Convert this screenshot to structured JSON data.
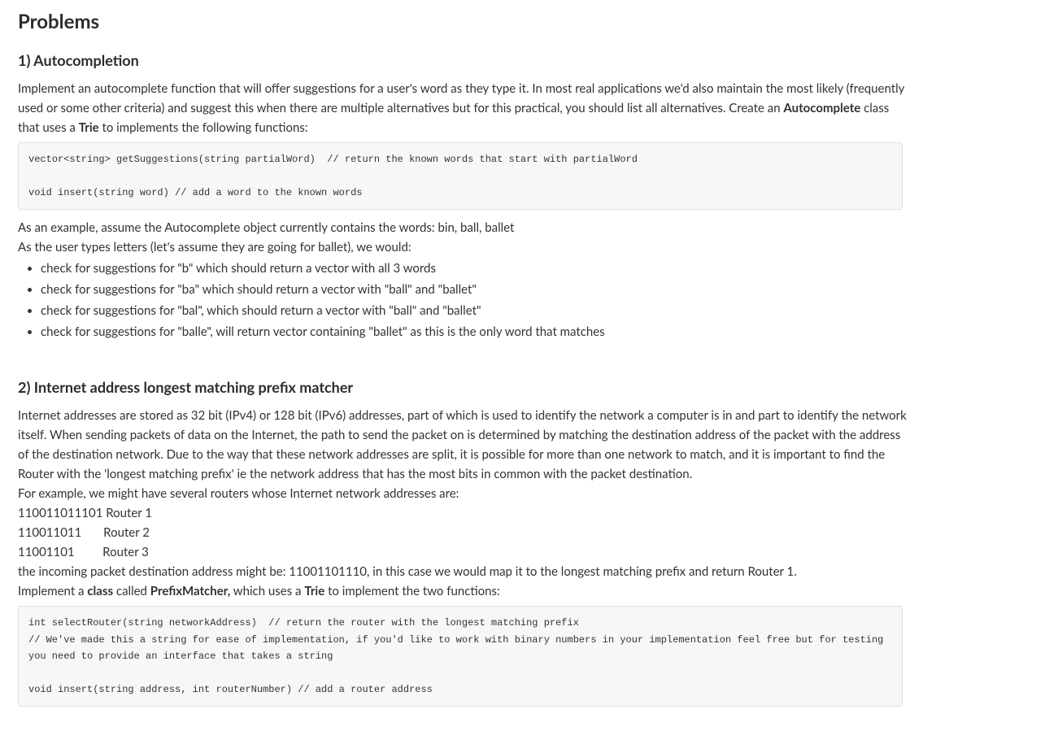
{
  "headings": {
    "main": "Problems",
    "problem1": "1) Autocompletion",
    "problem2": "2) Internet address longest matching prefix matcher"
  },
  "problem1": {
    "intro_prefix": "Implement an autocomplete function that will offer suggestions for a user's word as they type it.   In most real applications we'd also maintain the most likely (frequently used or some other criteria) and suggest this when there are multiple alternatives but for this practical, you should list all alternatives.  Create an ",
    "autocomplete_bold": "Autocomplete",
    "intro_mid": " class that uses a ",
    "trie_bold": "Trie",
    "intro_suffix": " to implements the following functions:",
    "code": "vector<string> getSuggestions(string partialWord)  // return the known words that start with partialWord\n\nvoid insert(string word) // add a word to the known words",
    "example_line1": "As an example, assume the Autocomplete object currently contains the words: bin, ball, ballet",
    "example_line2": "As the user types letters (let's assume they are going for ballet), we would:",
    "bullets": [
      "check for suggestions for \"b\" which should return a vector with all 3 words",
      "check for suggestions for \"ba\" which should return a vector with \"ball\" and \"ballet\"",
      "check for suggestions for \"bal\", which should return a vector with \"ball\" and \"ballet\"",
      "check for suggestions for \"balle\", will return vector containing \"ballet\" as this is the only word that matches"
    ]
  },
  "problem2": {
    "para1": "Internet addresses are stored as 32 bit (IPv4) or 128 bit (IPv6) addresses, part of which is used to identify the network a computer is in and part to identify the network itself.  When sending packets of data on the Internet, the path to send the packet on is determined by matching the destination address of the packet with the address of the destination network.  Due to the way that these network addresses are split, it is possible for more than one network to match, and it is important to find the Router with the 'longest matching prefix' ie the network address that has the most bits in common with the packet destination.",
    "para2": "For example, we might have several routers whose Internet network addresses are:",
    "router1": "110011011101 Router 1",
    "router2": "110011011       Router 2",
    "router3": "11001101         Router 3",
    "para3": "the incoming packet destination address might be: 11001101110, in this case we would map it to the longest matching prefix and return Router 1.",
    "impl_prefix": "Implement a ",
    "class_bold": "class",
    "impl_mid1": " called ",
    "prefixmatcher_bold": "PrefixMatcher,",
    "impl_mid2": " which uses a ",
    "trie_bold": "Trie",
    "impl_suffix": " to implement the two functions:",
    "code": "int selectRouter(string networkAddress)  // return the router with the longest matching prefix\n// We've made this a string for ease of implementation, if you'd like to work with binary numbers in your implementation feel free but for testing you need to provide an interface that takes a string \n\nvoid insert(string address, int routerNumber) // add a router address"
  }
}
